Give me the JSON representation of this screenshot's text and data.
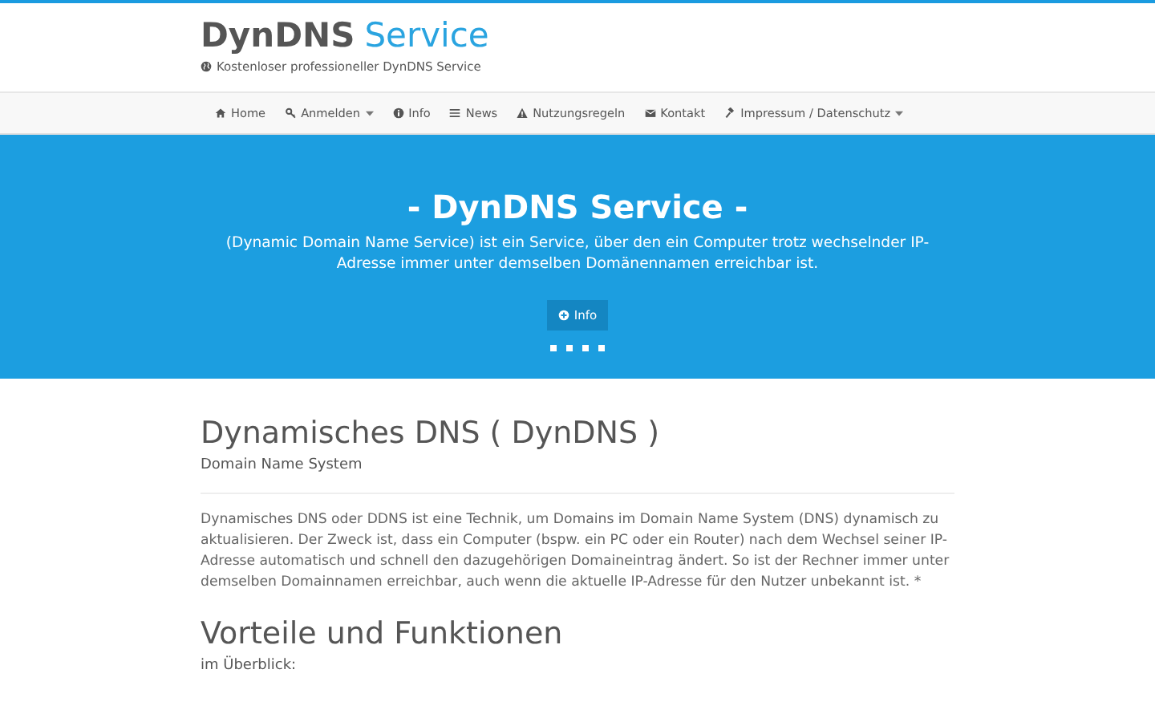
{
  "header": {
    "brand": "DynDNS",
    "brand_accent": "Service",
    "tagline": "Kostenloser professioneller DynDNS Service"
  },
  "nav": [
    {
      "label": "Home",
      "kind": "home",
      "dropdown": false
    },
    {
      "label": "Anmelden",
      "kind": "key",
      "dropdown": true
    },
    {
      "label": "Info",
      "kind": "info",
      "dropdown": false
    },
    {
      "label": "News",
      "kind": "list",
      "dropdown": false
    },
    {
      "label": "Nutzungsregeln",
      "kind": "warning",
      "dropdown": false
    },
    {
      "label": "Kontakt",
      "kind": "mail",
      "dropdown": false
    },
    {
      "label": "Impressum / Datenschutz",
      "kind": "hammer",
      "dropdown": true
    }
  ],
  "hero": {
    "title": "- DynDNS Service -",
    "text": "(Dynamic Domain Name Service) ist ein Service, über den ein Computer trotz wechselnder IP-Adresse immer unter demselben Domänennamen erreichbar ist.",
    "button": "Info"
  },
  "sections": [
    {
      "title": "Dynamisches DNS ( DynDNS )",
      "subtitle": "Domain Name System",
      "text": "Dynamisches DNS oder DDNS ist eine Technik, um Domains im Domain Name System (DNS) dynamisch zu aktualisieren. Der Zweck ist, dass ein Computer (bspw. ein PC oder ein Router) nach dem Wechsel seiner IP-Adresse automatisch und schnell den dazugehörigen Domaineintrag ändert. So ist der Rechner immer unter demselben Domainnamen erreichbar, auch wenn die aktuelle IP-Adresse für den Nutzer unbekannt ist. *"
    },
    {
      "title": "Vorteile und Funktionen",
      "subtitle": "im Überblick:"
    }
  ]
}
